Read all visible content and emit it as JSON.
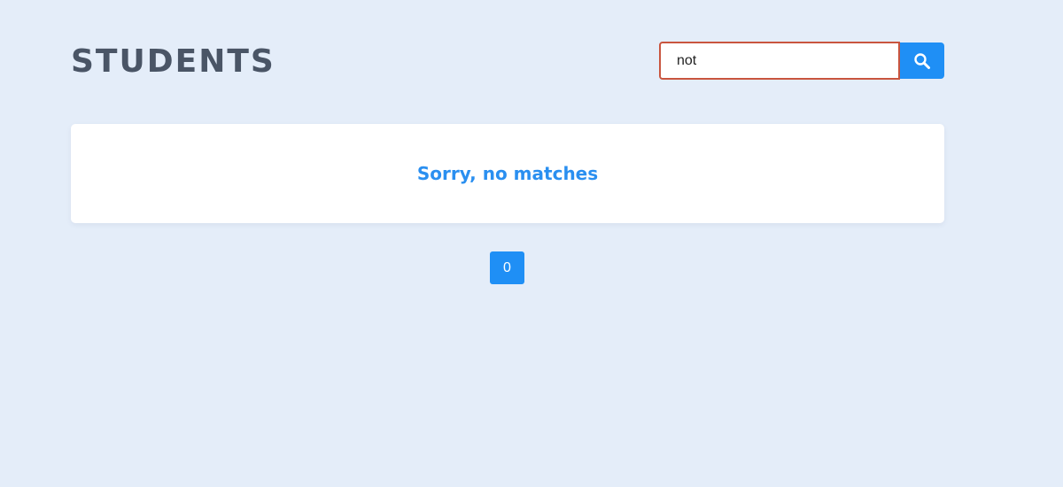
{
  "header": {
    "title": "STUDENTS"
  },
  "search": {
    "value": "not",
    "icon": "search-icon",
    "button_color": "#1f8ff5",
    "input_border_color": "#c9553f"
  },
  "results": {
    "empty_message": "Sorry, no matches"
  },
  "pagination": {
    "pages": [
      "0"
    ],
    "active_color": "#1f8ff5"
  },
  "colors": {
    "background": "#e4edf9",
    "accent": "#2a8ff0",
    "title": "#4a5566"
  }
}
